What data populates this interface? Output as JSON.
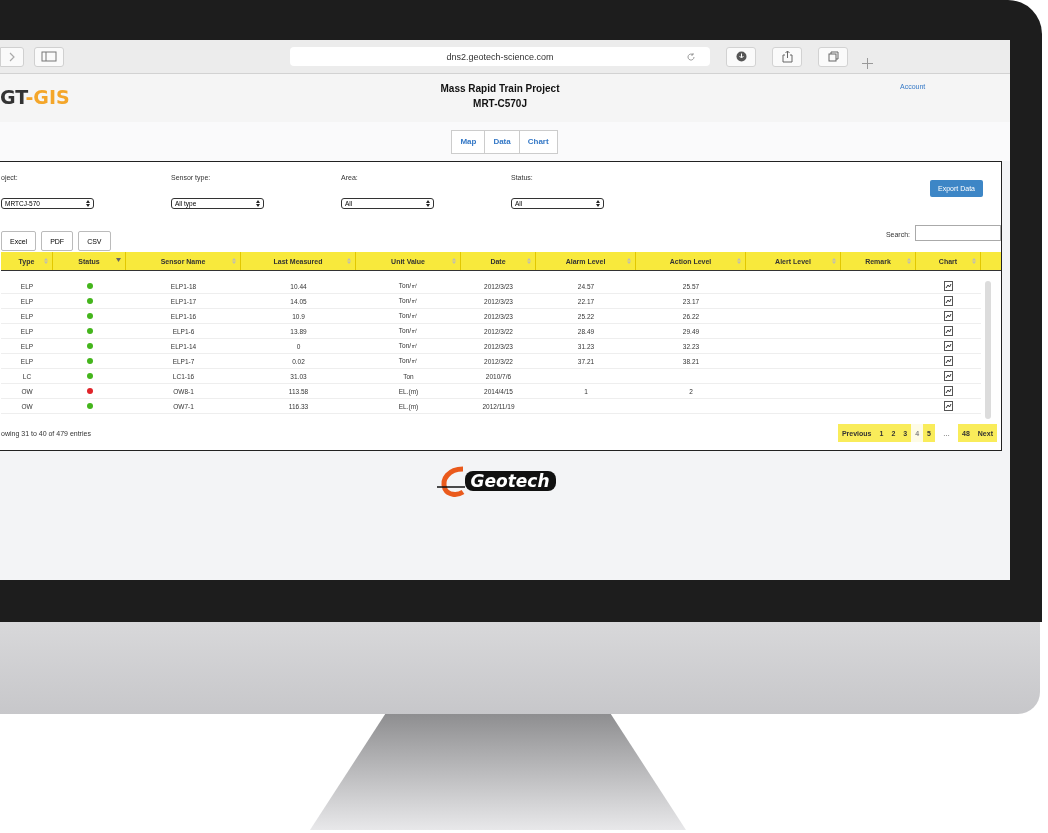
{
  "browser": {
    "url": "dns2.geotech-science.com"
  },
  "header": {
    "logo_prefix": "GT",
    "logo_suffix": "-GIS",
    "title": "Mass Rapid Train Project",
    "subtitle": "MRT-C570J",
    "account_link": "Account"
  },
  "tabs": [
    {
      "label": "Map",
      "selected": false
    },
    {
      "label": "Data",
      "selected": false
    },
    {
      "label": "Chart",
      "selected": false
    }
  ],
  "filters": [
    {
      "label": "oject:",
      "value": "MRTCJ-570"
    },
    {
      "label": "Sensor type:",
      "value": "All type"
    },
    {
      "label": "Area:",
      "value": "All"
    },
    {
      "label": "Status:",
      "value": "All"
    }
  ],
  "export_button": "Export Data",
  "export_formats": [
    "Excel",
    "PDF",
    "CSV"
  ],
  "search": {
    "label": "Search:"
  },
  "table": {
    "columns": [
      {
        "label": "Type",
        "sorted": false
      },
      {
        "label": "Status",
        "sorted": true
      },
      {
        "label": "Sensor Name",
        "sorted": false
      },
      {
        "label": "Last Measured",
        "sorted": false
      },
      {
        "label": "Unit Value",
        "sorted": false
      },
      {
        "label": "Date",
        "sorted": false
      },
      {
        "label": "Alarm Level",
        "sorted": false
      },
      {
        "label": "Action Level",
        "sorted": false
      },
      {
        "label": "Alert Level",
        "sorted": false
      },
      {
        "label": "Remark",
        "sorted": false
      },
      {
        "label": "Chart",
        "sorted": false
      }
    ],
    "rows": [
      {
        "type": "ELP",
        "color": "#44b51c",
        "sensor": "ELP1-18",
        "last": "10.44",
        "unit": "Ton/㎡",
        "date": "2012/3/23",
        "alarm": "24.57",
        "action": "25.57"
      },
      {
        "type": "ELP",
        "color": "#44b51c",
        "sensor": "ELP1-17",
        "last": "14.05",
        "unit": "Ton/㎡",
        "date": "2012/3/23",
        "alarm": "22.17",
        "action": "23.17"
      },
      {
        "type": "ELP",
        "color": "#44b51c",
        "sensor": "ELP1-16",
        "last": "10.9",
        "unit": "Ton/㎡",
        "date": "2012/3/23",
        "alarm": "25.22",
        "action": "26.22"
      },
      {
        "type": "ELP",
        "color": "#44b51c",
        "sensor": "ELP1-6",
        "last": "13.89",
        "unit": "Ton/㎡",
        "date": "2012/3/22",
        "alarm": "28.49",
        "action": "29.49"
      },
      {
        "type": "ELP",
        "color": "#44b51c",
        "sensor": "ELP1-14",
        "last": "0",
        "unit": "Ton/㎡",
        "date": "2012/3/23",
        "alarm": "31.23",
        "action": "32.23"
      },
      {
        "type": "ELP",
        "color": "#44b51c",
        "sensor": "ELP1-7",
        "last": "0.02",
        "unit": "Ton/㎡",
        "date": "2012/3/22",
        "alarm": "37.21",
        "action": "38.21"
      },
      {
        "type": "LC",
        "color": "#44b51c",
        "sensor": "LC1-16",
        "last": "31.03",
        "unit": "Ton",
        "date": "2010/7/6"
      },
      {
        "type": "OW",
        "color": "#e0242a",
        "sensor": "OW8-1",
        "last": "113.58",
        "unit": "EL.(m)",
        "date": "2014/4/15",
        "alarm": "1",
        "action": "2"
      },
      {
        "type": "OW",
        "color": "#44b51c",
        "sensor": "OW7-1",
        "last": "116.33",
        "unit": "EL.(m)",
        "date": "2012/11/19"
      }
    ]
  },
  "info": "owing 31 to 40 of 479 entries",
  "brand": "Geotech",
  "pagination": {
    "previous": "Previous",
    "pages": [
      {
        "label": "1",
        "selected": false
      },
      {
        "label": "2",
        "selected": false
      },
      {
        "label": "3",
        "selected": false
      },
      {
        "label": "4",
        "selected": true
      },
      {
        "label": "5",
        "selected": false
      }
    ],
    "ellipsis": "…",
    "last": "48",
    "next": "Next"
  }
}
